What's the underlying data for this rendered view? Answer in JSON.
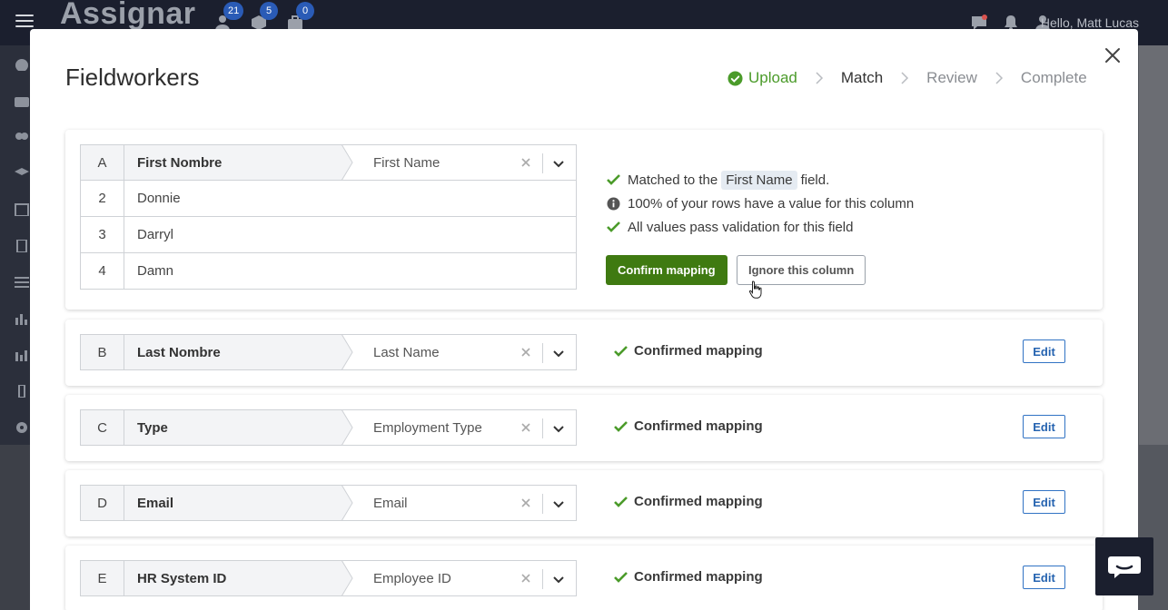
{
  "app": {
    "brand": "Assignar",
    "badges": [
      "21",
      "5",
      "0"
    ],
    "greeting": "Hello, Matt Lucas"
  },
  "modal": {
    "title": "Fieldworkers",
    "steps": [
      {
        "label": "Upload",
        "state": "done"
      },
      {
        "label": "Match",
        "state": "active"
      },
      {
        "label": "Review",
        "state": "pending"
      },
      {
        "label": "Complete",
        "state": "pending"
      }
    ]
  },
  "expanded_column": {
    "letter": "A",
    "source": "First Nombre",
    "target": "First Name",
    "rows": [
      {
        "num": "2",
        "value": "Donnie"
      },
      {
        "num": "3",
        "value": "Darryl"
      },
      {
        "num": "4",
        "value": "Damn"
      }
    ],
    "info": {
      "matched_prefix": "Matched to the",
      "matched_field": "First Name",
      "matched_suffix": "field.",
      "coverage": "100% of your rows have a value for this column",
      "validation": "All values pass validation for this field"
    },
    "confirm_label": "Confirm mapping",
    "ignore_label": "Ignore this column"
  },
  "columns": [
    {
      "letter": "B",
      "source": "Last Nombre",
      "target": "Last Name",
      "status": "Confirmed mapping",
      "edit": "Edit"
    },
    {
      "letter": "C",
      "source": "Type",
      "target": "Employment Type",
      "status": "Confirmed mapping",
      "edit": "Edit"
    },
    {
      "letter": "D",
      "source": "Email",
      "target": "Email",
      "status": "Confirmed mapping",
      "edit": "Edit"
    },
    {
      "letter": "E",
      "source": "HR System ID",
      "target": "Employee ID",
      "status": "Confirmed mapping",
      "edit": "Edit"
    }
  ],
  "colors": {
    "success": "#4b9b2a",
    "confirm_button": "#3f7a11",
    "edit_button": "#3173c4",
    "topbar": "#1b1f2e"
  }
}
